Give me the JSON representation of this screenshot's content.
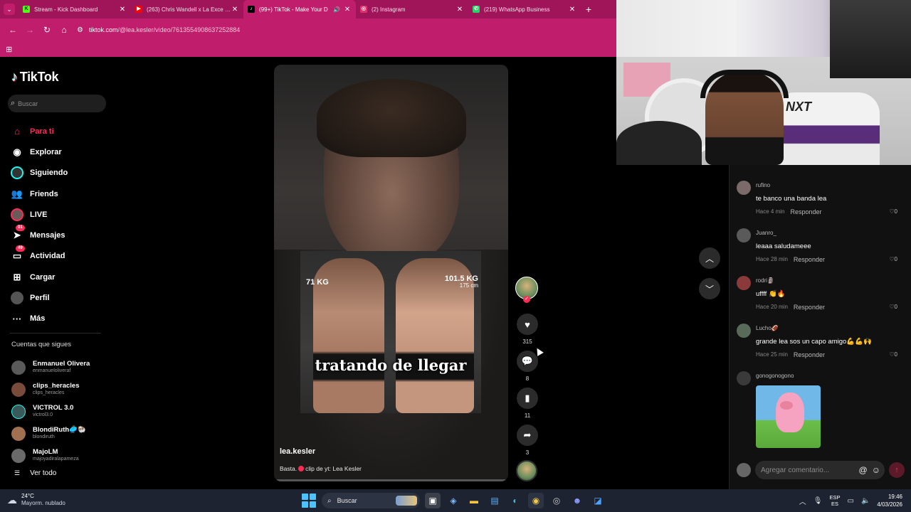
{
  "browser": {
    "tabs": [
      {
        "title": "Stream - Kick Dashboard",
        "favicon": "K",
        "color": "#53fc18"
      },
      {
        "title": "(263) Chris Wandell x La Exce x /",
        "favicon": "▶",
        "color": "#ff0000"
      },
      {
        "title": "(99+) TikTok - Make Your D",
        "favicon": "♪",
        "color": "#000000"
      },
      {
        "title": "(2) Instagram",
        "favicon": "◎",
        "color": "#e1306c"
      },
      {
        "title": "(219) WhatsApp Business",
        "favicon": "✆",
        "color": "#25d366"
      }
    ],
    "url_host": "tiktok.com",
    "url_path": "/@lea.kesler/video/7613554908637252884"
  },
  "sidebar": {
    "logo": "TikTok",
    "search_placeholder": "Buscar",
    "nav": [
      {
        "label": "Para ti",
        "icon": "home-icon",
        "active": true
      },
      {
        "label": "Explorar",
        "icon": "compass-icon"
      },
      {
        "label": "Siguiendo",
        "icon": "following-icon"
      },
      {
        "label": "Friends",
        "icon": "friends-icon"
      },
      {
        "label": "LIVE",
        "icon": "live-icon"
      },
      {
        "label": "Mensajes",
        "icon": "send-icon",
        "badge": "91"
      },
      {
        "label": "Actividad",
        "icon": "inbox-icon",
        "badge": "49"
      },
      {
        "label": "Cargar",
        "icon": "upload-icon"
      },
      {
        "label": "Perfil",
        "icon": "profile-icon"
      },
      {
        "label": "Más",
        "icon": "more-icon"
      }
    ],
    "following_title": "Cuentas que sigues",
    "following": [
      {
        "name": "Enmanuel Olivera",
        "handle": "enmanueloliveraf"
      },
      {
        "name": "clips_heracles",
        "handle": "clips_heracles"
      },
      {
        "name": "VICTROL 3.0",
        "handle": "victrol3.0"
      },
      {
        "name": "BlondiRuth🥏🐏",
        "handle": "blondiruth"
      },
      {
        "name": "MajoLM",
        "handle": "majoyadiralapameza"
      }
    ],
    "see_all": "Ver todo"
  },
  "video": {
    "label_left": "71 KG",
    "label_right": "101.5 KG",
    "label_right_sub": "175 cm",
    "overlay_text": "tratando de llegar",
    "author": "lea.kesler",
    "description_pre": "Basta.",
    "description_post": "clip de yt: Lea Kesler"
  },
  "actions": {
    "likes": "315",
    "comments": "8",
    "saves": "11",
    "shares": "3"
  },
  "comments": [
    {
      "user": "rufino",
      "text": "te banco una banda lea",
      "time": "Hace 4 min",
      "reply": "Responder",
      "likes": "0"
    },
    {
      "user": "Juanro_",
      "text": "leaaa saludameee",
      "time": "Hace 28 min",
      "reply": "Responder",
      "likes": "0"
    },
    {
      "user": "rodri🗿",
      "text": "uffff 👏🔥",
      "time": "Hace 20 min",
      "reply": "Responder",
      "likes": "0"
    },
    {
      "user": "Lucho🏈",
      "text": "grande lea sos un capo amigo💪💪🙌",
      "time": "Hace 25 min",
      "reply": "Responder",
      "likes": "0"
    },
    {
      "user": "gonogonogono",
      "text": "",
      "time": "",
      "reply": "",
      "likes": ""
    }
  ],
  "comment_input_placeholder": "Agregar comentario...",
  "webcam": {
    "chair_brand": "NXT"
  },
  "taskbar": {
    "temp": "24°C",
    "weather": "Mayorm. nublado",
    "search": "Buscar",
    "lang_top": "ESP",
    "lang_bottom": "ES",
    "time": "19:46",
    "date": "4/03/2026"
  }
}
